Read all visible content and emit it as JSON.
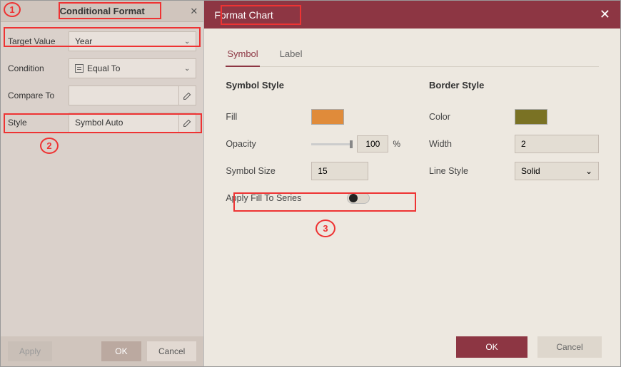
{
  "leftPanel": {
    "title": "Conditional Format",
    "fields": {
      "targetValue": {
        "label": "Target Value",
        "value": "Year"
      },
      "condition": {
        "label": "Condition",
        "value": "Equal To"
      },
      "compareTo": {
        "label": "Compare To",
        "value": ""
      },
      "style": {
        "label": "Style",
        "value": "Symbol Auto"
      }
    },
    "buttons": {
      "apply": "Apply",
      "ok": "OK",
      "cancel": "Cancel"
    }
  },
  "rightPanel": {
    "title": "Format Chart",
    "tabs": {
      "symbol": "Symbol",
      "label": "Label"
    },
    "symbolStyle": {
      "heading": "Symbol Style",
      "fill": {
        "label": "Fill",
        "color": "#e08b3a"
      },
      "opacity": {
        "label": "Opacity",
        "value": "100",
        "unit": "%"
      },
      "symbolSize": {
        "label": "Symbol Size",
        "value": "15"
      },
      "applyFillToSeries": {
        "label": "Apply Fill To Series",
        "on": false
      }
    },
    "borderStyle": {
      "heading": "Border Style",
      "color": {
        "label": "Color",
        "value": "#7a7224"
      },
      "width": {
        "label": "Width",
        "value": "2"
      },
      "lineStyle": {
        "label": "Line Style",
        "value": "Solid"
      }
    },
    "buttons": {
      "ok": "OK",
      "cancel": "Cancel"
    }
  },
  "annotations": {
    "one": "1",
    "two": "2",
    "three": "3"
  }
}
